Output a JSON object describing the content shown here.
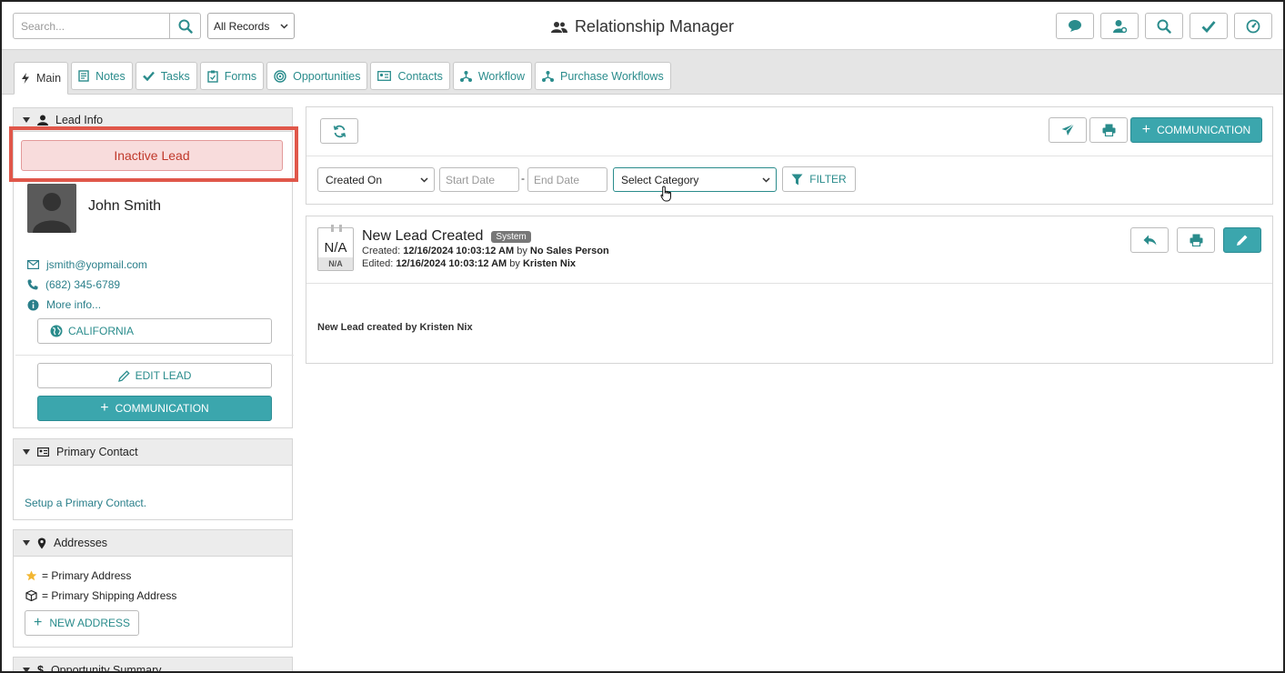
{
  "header": {
    "search_placeholder": "Search...",
    "records_select": "All Records",
    "app_title": "Relationship Manager",
    "top_icons": [
      "chat-icon",
      "user-settings-icon",
      "search-icon",
      "check-icon",
      "dashboard-icon"
    ]
  },
  "tabs": [
    {
      "label": "Main",
      "icon": "bolt-icon",
      "active": true
    },
    {
      "label": "Notes",
      "icon": "notes-icon"
    },
    {
      "label": "Tasks",
      "icon": "check-icon"
    },
    {
      "label": "Forms",
      "icon": "clipboard-icon"
    },
    {
      "label": "Opportunities",
      "icon": "target-icon"
    },
    {
      "label": "Contacts",
      "icon": "id-card-icon"
    },
    {
      "label": "Workflow",
      "icon": "workflow-icon"
    },
    {
      "label": "Purchase Workflows",
      "icon": "workflow-icon"
    }
  ],
  "lead_info": {
    "header": "Lead Info",
    "status": "Inactive Lead",
    "name": "John Smith",
    "email": "jsmith@yopmail.com",
    "phone": "(682) 345-6789",
    "more_info": "More info...",
    "state": "CALIFORNIA",
    "edit_label": "EDIT LEAD",
    "communication_label": "COMMUNICATION"
  },
  "primary_contact": {
    "header": "Primary Contact",
    "link": "Setup a Primary Contact."
  },
  "addresses": {
    "header": "Addresses",
    "legend_primary": "= Primary Address",
    "legend_shipping": "= Primary Shipping Address",
    "new_label": "NEW ADDRESS"
  },
  "opportunity_summary": {
    "header": "Opportunity Summary"
  },
  "toolbar": {
    "communication_label": "COMMUNICATION",
    "date_field": "Created On",
    "start_placeholder": "Start Date",
    "end_placeholder": "End Date",
    "date_separator": "-",
    "category": "Select Category",
    "filter_label": "FILTER"
  },
  "entry": {
    "date_big": "N/A",
    "date_small": "N/A",
    "title": "New Lead Created",
    "badge": "System",
    "created_label": "Created:",
    "created_at": "12/16/2024 10:03:12 AM",
    "created_by_label": "by",
    "created_by": "No Sales Person",
    "edited_label": "Edited:",
    "edited_at": "12/16/2024 10:03:12 AM",
    "edited_by_label": "by",
    "edited_by": "Kristen Nix",
    "body": "New Lead created by Kristen Nix"
  },
  "colors": {
    "teal": "#3ba6ad",
    "link": "#2a7f8a",
    "inactive_bg": "#f8dcdc",
    "inactive_text": "#c0392b",
    "highlight_border": "#e0574a"
  }
}
